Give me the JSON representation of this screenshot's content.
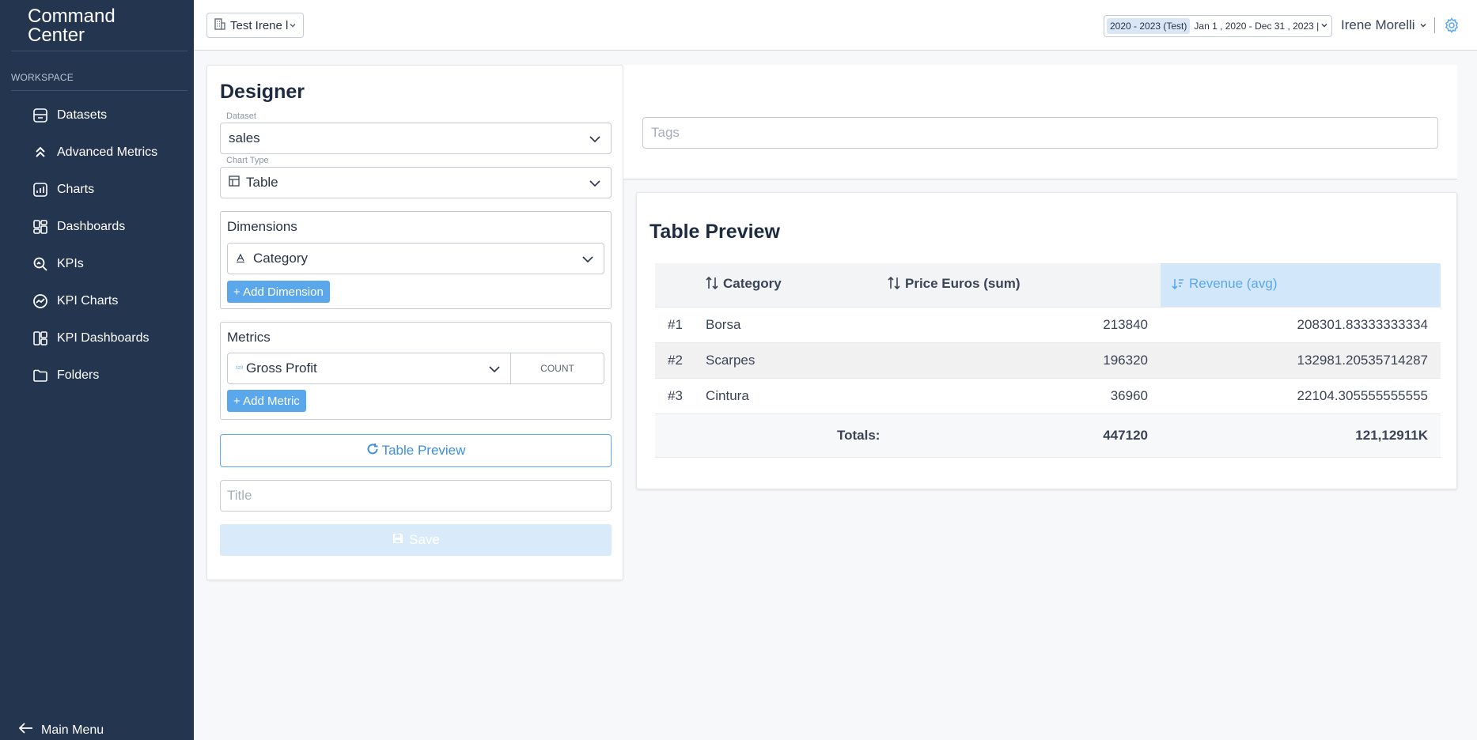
{
  "sidebar": {
    "brand_line1": "Command",
    "brand_line2": "Center",
    "section_label": "WORKSPACE",
    "items": [
      {
        "label": "Datasets"
      },
      {
        "label": "Advanced Metrics"
      },
      {
        "label": "Charts"
      },
      {
        "label": "Dashboards"
      },
      {
        "label": "KPIs"
      },
      {
        "label": "KPI Charts"
      },
      {
        "label": "KPI Dashboards"
      },
      {
        "label": "Folders"
      }
    ],
    "main_menu": "Main Menu"
  },
  "topbar": {
    "workspace": "Test Irene l",
    "date_badge": "2020 - 2023 (Test)",
    "date_range": "Jan 1 , 2020 - Dec 31 , 2023 |",
    "user": "Irene Morelli",
    "separator": "|"
  },
  "designer": {
    "title": "Designer",
    "dataset_label": "Dataset",
    "dataset_value": "sales",
    "chart_type_label": "Chart Type",
    "chart_type_value": "Table",
    "dimensions_title": "Dimensions",
    "dimension_value": "Category",
    "add_dimension": "+ Add Dimension",
    "metrics_title": "Metrics",
    "metric_value": "Gross Profit",
    "metric_agg": "COUNT",
    "add_metric": "+ Add Metric",
    "preview_button": "Table Preview",
    "title_placeholder": "Title",
    "save_button": "Save"
  },
  "tags": {
    "placeholder": "Tags"
  },
  "preview": {
    "title": "Table Preview",
    "columns": [
      "",
      "Category",
      "Price Euros (sum)",
      "Revenue (avg)"
    ],
    "rows": [
      {
        "rank": "#1",
        "category": "Borsa",
        "price": "213840",
        "revenue": "208301.83333333334"
      },
      {
        "rank": "#2",
        "category": "Scarpes",
        "price": "196320",
        "revenue": "132981.20535714287"
      },
      {
        "rank": "#3",
        "category": "Cintura",
        "price": "36960",
        "revenue": "22104.305555555555"
      }
    ],
    "totals_label": "Totals:",
    "totals_price": "447120",
    "totals_revenue": "121,12911K"
  },
  "colors": {
    "sidebar": "#243550",
    "accent": "#5aa8eb",
    "sort_active_bg": "#d3e7fa"
  }
}
